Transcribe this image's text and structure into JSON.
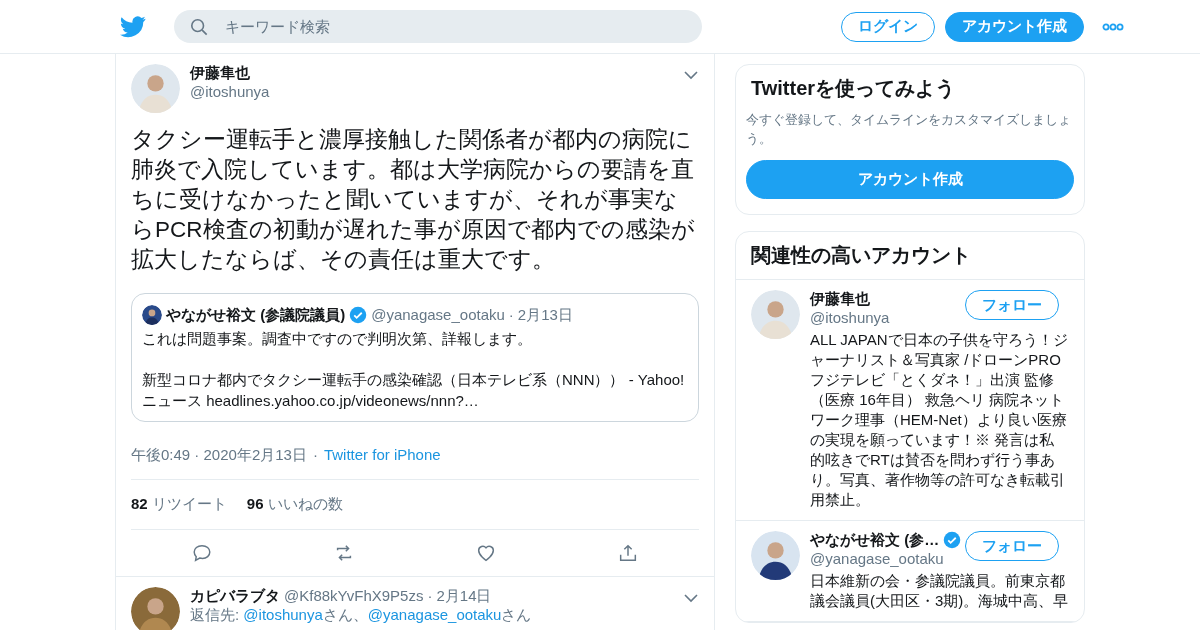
{
  "header": {
    "search": {
      "placeholder": "キーワード検索"
    },
    "login": "ログイン",
    "signup": "アカウント作成"
  },
  "tweet": {
    "name": "伊藤隼也",
    "handle": "@itoshunya",
    "text": "タクシー運転手と濃厚接触した関係者が都内の病院に肺炎で入院しています。都は大学病院からの要請を直ちに受けなかったと聞いていますが、それが事実ならPCR検査の初動が遅れた事が原因で都内での感染が拡大したならば、その責任は重大です。",
    "quote": {
      "name": "やながせ裕文 (参議院議員)",
      "verified": true,
      "handle": "@yanagase_ootaku",
      "dot": "·",
      "date": "2月13日",
      "text": "これは問題事案。調査中ですので判明次第、詳報します。",
      "link_text": "新型コロナ都内でタクシー運転手の感染確認（日本テレビ系（NNN）） - Yahoo!ニュース headlines.yahoo.co.jp/videonews/nnn?…"
    },
    "time": "午後0:49 · 2020年2月13日",
    "dot": "·",
    "source": "Twitter for iPhone",
    "retweets": "82",
    "retweets_label": "リツイート",
    "likes": "96",
    "likes_label": "いいねの数"
  },
  "reply": {
    "name": "カピバラブタ",
    "handle": "@Kf88kYvFhX9P5zs",
    "dot": "·",
    "date": "2月14日",
    "reply_prefix": "返信先: ",
    "reply_to": [
      {
        "handle": "@itoshunya",
        "suffix": "さん"
      },
      {
        "handle": "@yanagase_ootaku",
        "suffix": "さん"
      }
    ],
    "separator": "、"
  },
  "signup_card": {
    "title": "Twitterを使ってみよう",
    "text": "今すぐ登録して、タイムラインをカスタマイズしましょう。",
    "button": "アカウント作成"
  },
  "related": {
    "title": "関連性の高いアカウント",
    "accounts": [
      {
        "name": "伊藤隼也",
        "verified": false,
        "handle": "@itoshunya",
        "follow": "フォロー",
        "bio": "ALL JAPANで日本の子供を守ろう！ジャーナリスト＆写真家 /ドローンPRO フジテレビ「とくダネ！」出演 監修（医療 16年目） 救急ヘリ 病院ネットワーク理事（HEM-Net）より良い医療の実現を願っています！※ 発言は私的呟きでRTは賛否を問わず行う事あり。写真、著作物等の許可なき転載引用禁止。"
      },
      {
        "name": "やながせ裕文 (参…",
        "verified": true,
        "handle": "@yanagase_ootaku",
        "follow": "フォロー",
        "bio": "日本維新の会・参議院議員。前東京都議会議員(大田区・3期)。海城中高、早"
      }
    ]
  }
}
